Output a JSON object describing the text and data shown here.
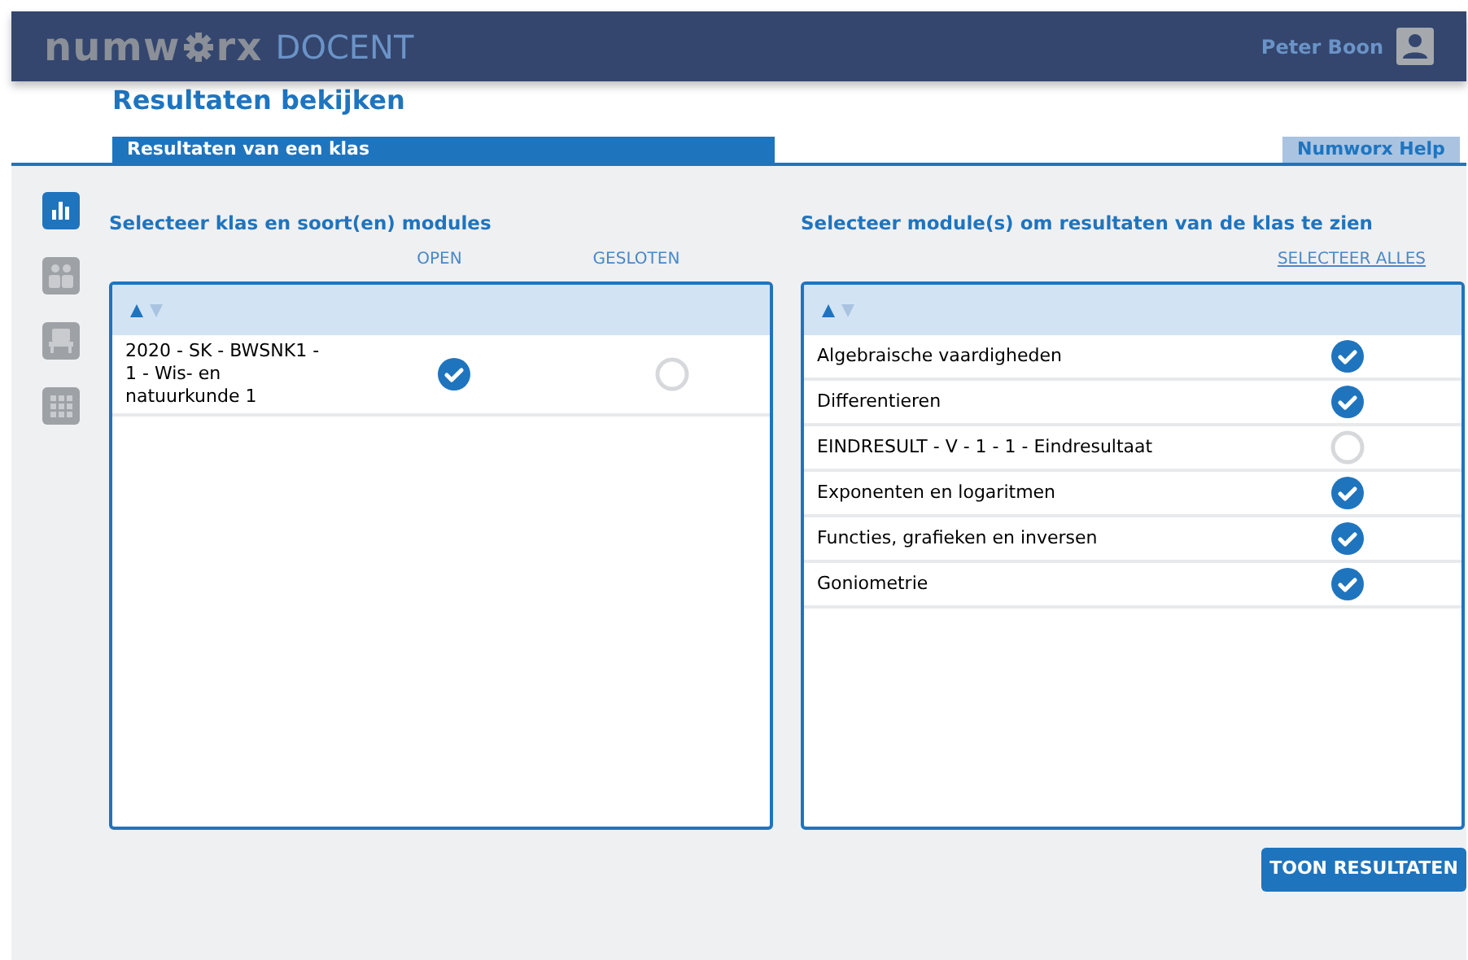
{
  "header": {
    "logo_start": "numw",
    "logo_end": "rx",
    "app_name": "DOCENT",
    "user_name": "Peter Boon"
  },
  "page_title": "Resultaten bekijken",
  "tabs": [
    {
      "label": "Resultaten van een klas",
      "selected": true
    },
    {
      "label": "Numworx Help",
      "selected": false
    }
  ],
  "sidebar": {
    "items": [
      {
        "kind": "chart",
        "selected": true
      },
      {
        "kind": "people",
        "selected": false
      },
      {
        "kind": "seat",
        "selected": false
      },
      {
        "kind": "grid",
        "selected": false
      }
    ]
  },
  "left_panel": {
    "heading": "Selecteer klas en soort(en) modules",
    "columns": [
      "OPEN",
      "GESLOTEN"
    ],
    "rows": [
      {
        "name": "2020 - SK - BWSNK1 - 1 - Wis- en natuurkunde 1",
        "open": true,
        "closed": false
      }
    ]
  },
  "right_panel": {
    "heading": "Selecteer module(s) om resultaten van de klas te zien",
    "select_all": "SELECTEER ALLES",
    "modules": [
      {
        "name": "Algebraische vaardigheden",
        "selected": true
      },
      {
        "name": "Differentieren",
        "selected": true
      },
      {
        "name": "EINDRESULT - V - 1 - 1 - Eindresultaat",
        "selected": false
      },
      {
        "name": "Exponenten en logaritmen",
        "selected": true
      },
      {
        "name": "Functies, grafieken en inversen",
        "selected": true
      },
      {
        "name": "Goniometrie",
        "selected": true
      }
    ]
  },
  "submit_button": "TOON RESULTATEN"
}
